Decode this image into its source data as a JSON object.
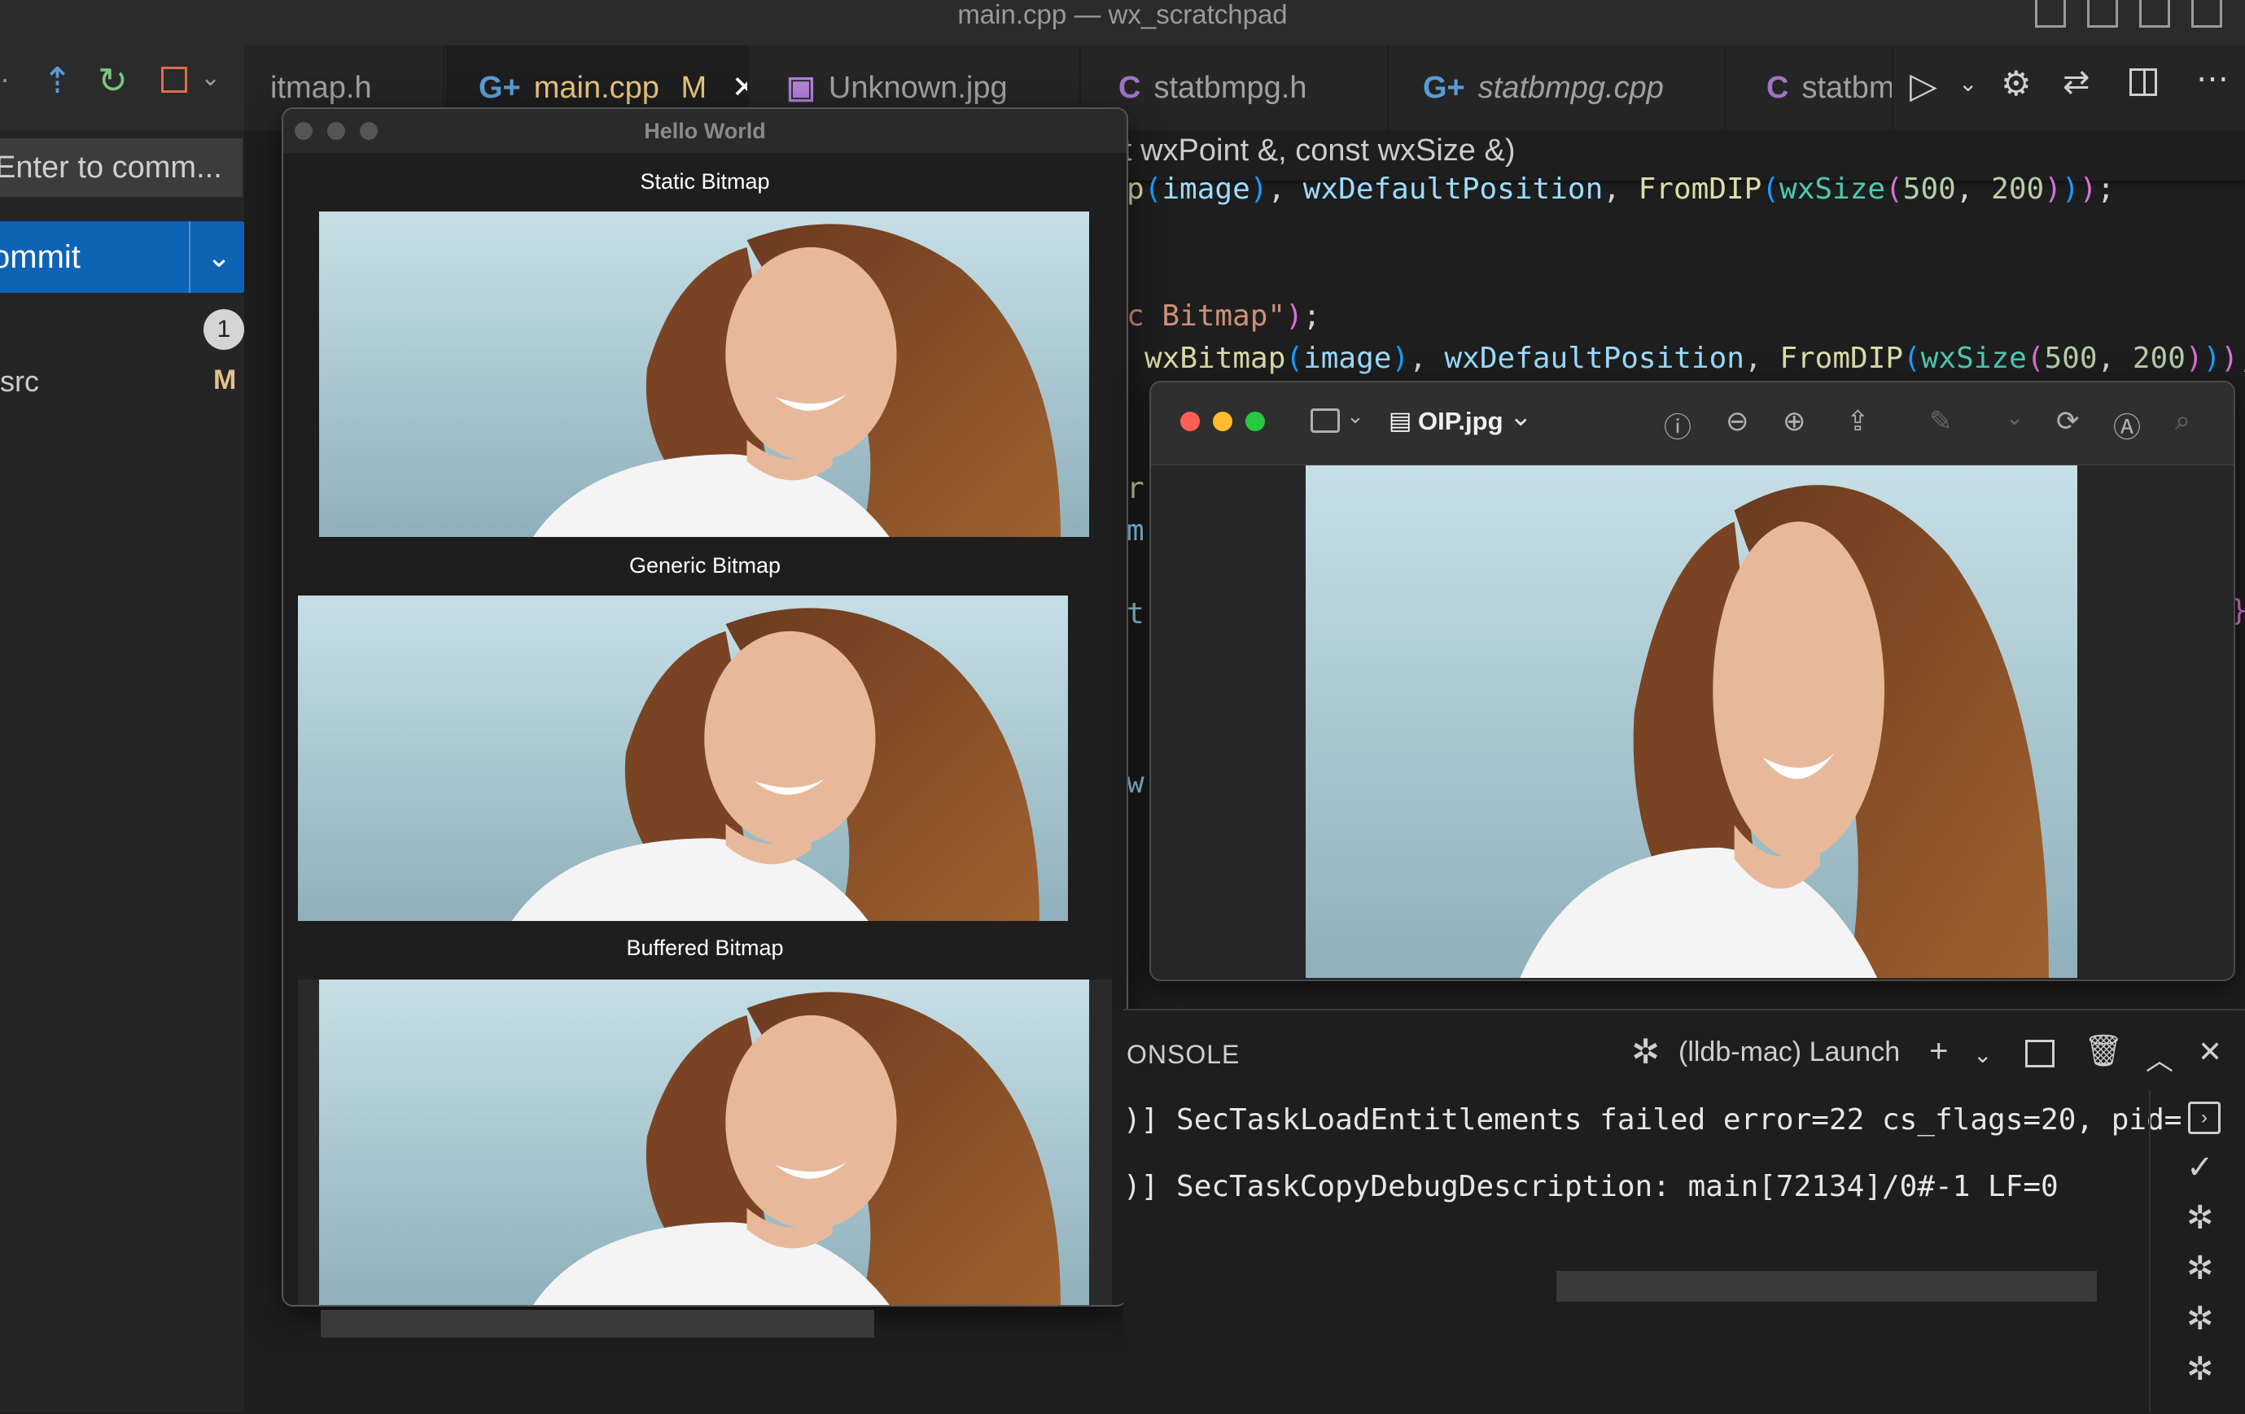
{
  "window": {
    "title": "main.cpp — wx_scratchpad"
  },
  "tabs": [
    {
      "label": "itmap.h",
      "icon": ""
    },
    {
      "label": "main.cpp",
      "icon": "G+",
      "badge": "M",
      "close": "✕"
    },
    {
      "label": "Unknown.jpg",
      "icon": "▣"
    },
    {
      "label": "statbmpg.h",
      "icon": "C"
    },
    {
      "label": "statbmpg.cpp",
      "icon": "G+"
    },
    {
      "label": "statbm",
      "icon": "C"
    }
  ],
  "scm": {
    "commit_placeholder": "Enter to comm...",
    "commit_label": "ommit",
    "changes_count": "1",
    "folder": "src",
    "folder_badge": "M"
  },
  "editor": {
    "breadcrumb": "t wxPoint &, const wxSize &)"
  },
  "hello_window": {
    "title": "Hello World",
    "sections": [
      "Static Bitmap",
      "Generic Bitmap",
      "Buffered Bitmap"
    ]
  },
  "preview_window": {
    "filename": "OIP.jpg"
  },
  "panel": {
    "tab_label": "ONSOLE",
    "launch_config": "(lldb-mac) Launch",
    "output_lines": [
      ")] SecTaskLoadEntitlements failed error=22 cs_flags=20, pid=",
      ")] SecTaskCopyDebugDescription: main[72134]/0#-1 LF=0"
    ]
  },
  "colors": {
    "accent_blue": "#0e63b5",
    "modified_badge": "#e2c08d",
    "editor_bg": "#1e1e1e"
  }
}
